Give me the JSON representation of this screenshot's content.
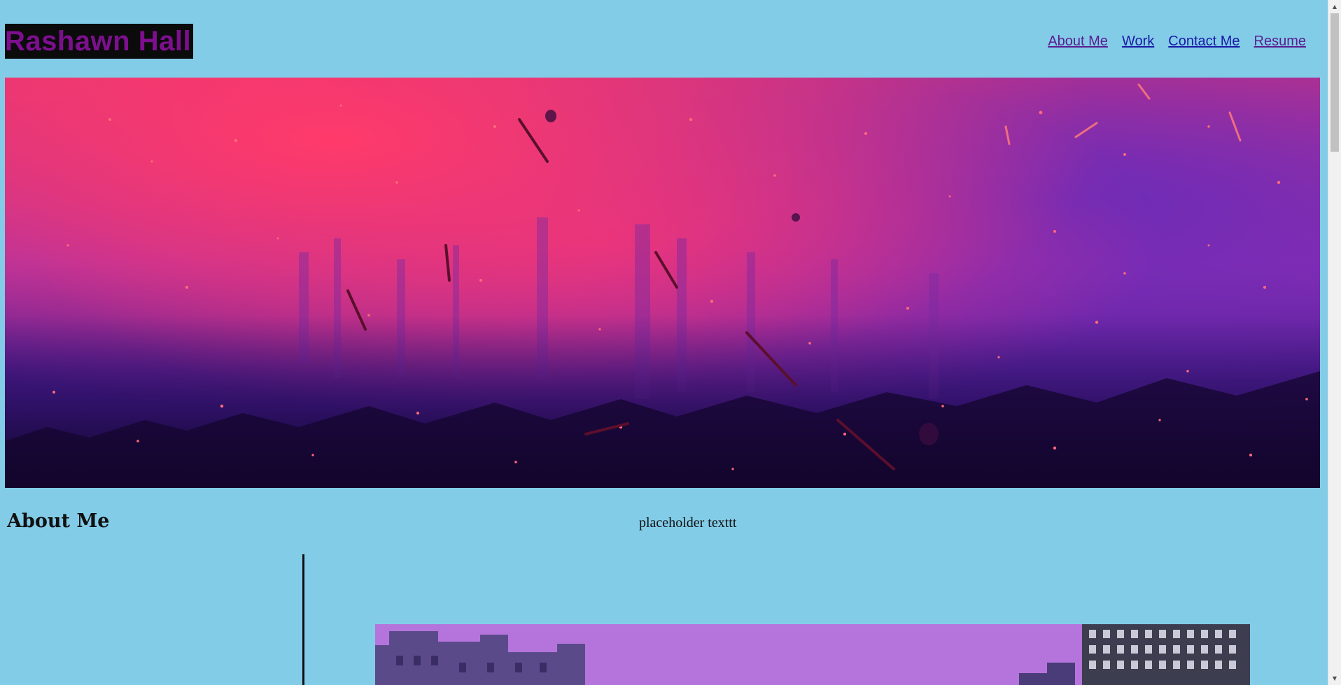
{
  "header": {
    "brand": "Rashawn Hall",
    "nav": [
      {
        "label": "About Me",
        "visited": true
      },
      {
        "label": "Work",
        "visited": false
      },
      {
        "label": "Contact Me",
        "visited": false
      },
      {
        "label": "Resume",
        "visited": true
      }
    ]
  },
  "hero": {
    "image": "abstract-pink-purple-paint-splatter"
  },
  "about": {
    "heading": "About Me",
    "text": "placeholder texttt"
  },
  "photo": {
    "image": "city-buildings-purple-sky"
  },
  "colors": {
    "background": "#82cce8",
    "brand_text": "#7d0f8f",
    "brand_bg": "#0b0b0b",
    "link": "#1a1aa6",
    "link_visited": "#5a1d8f"
  },
  "scrollbar": {
    "up_icon": "arrow-up-icon",
    "down_icon": "arrow-down-icon"
  }
}
